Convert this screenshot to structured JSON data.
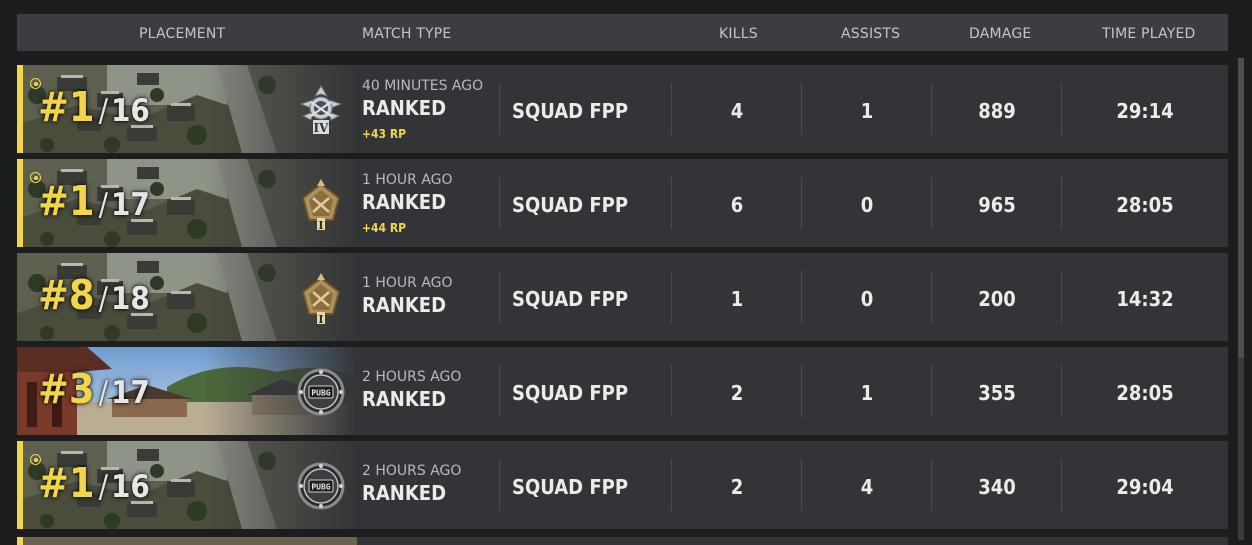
{
  "header": {
    "placement": "PLACEMENT",
    "match_type": "MATCH TYPE",
    "kills": "KILLS",
    "assists": "ASSISTS",
    "damage": "DAMAGE",
    "time_played": "TIME PLAYED"
  },
  "colors": {
    "accent": "#f2d64a",
    "row_bg": "#333437",
    "header_bg": "#3c3d40"
  },
  "matches": [
    {
      "place": "#1",
      "total": "16",
      "win": true,
      "map": "erangel",
      "rank_icon": "diamond-iv-icon",
      "when": "40 MINUTES AGO",
      "mode": "RANKED",
      "rp": "+43 RP",
      "type": "SQUAD FPP",
      "kills": "4",
      "assists": "1",
      "damage": "889",
      "time": "29:14"
    },
    {
      "place": "#1",
      "total": "17",
      "win": true,
      "map": "erangel",
      "rank_icon": "gold-i-icon",
      "when": "1 HOUR AGO",
      "mode": "RANKED",
      "rp": "+44 RP",
      "type": "SQUAD FPP",
      "kills": "6",
      "assists": "0",
      "damage": "965",
      "time": "28:05"
    },
    {
      "place": "#8",
      "total": "18",
      "win": false,
      "map": "erangel",
      "rank_icon": "gold-i-icon",
      "when": "1 HOUR AGO",
      "mode": "RANKED",
      "rp": "",
      "type": "SQUAD FPP",
      "kills": "1",
      "assists": "0",
      "damage": "200",
      "time": "14:32"
    },
    {
      "place": "#3",
      "total": "17",
      "win": false,
      "map": "taego",
      "rank_icon": "pubg-unranked-icon",
      "when": "2 HOURS AGO",
      "mode": "RANKED",
      "rp": "",
      "type": "SQUAD FPP",
      "kills": "2",
      "assists": "1",
      "damage": "355",
      "time": "28:05"
    },
    {
      "place": "#1",
      "total": "16",
      "win": true,
      "map": "erangel",
      "rank_icon": "pubg-unranked-icon",
      "when": "2 HOURS AGO",
      "mode": "RANKED",
      "rp": "",
      "type": "SQUAD FPP",
      "kills": "2",
      "assists": "4",
      "damage": "340",
      "time": "29:04"
    }
  ],
  "badge_text": "PUBG"
}
